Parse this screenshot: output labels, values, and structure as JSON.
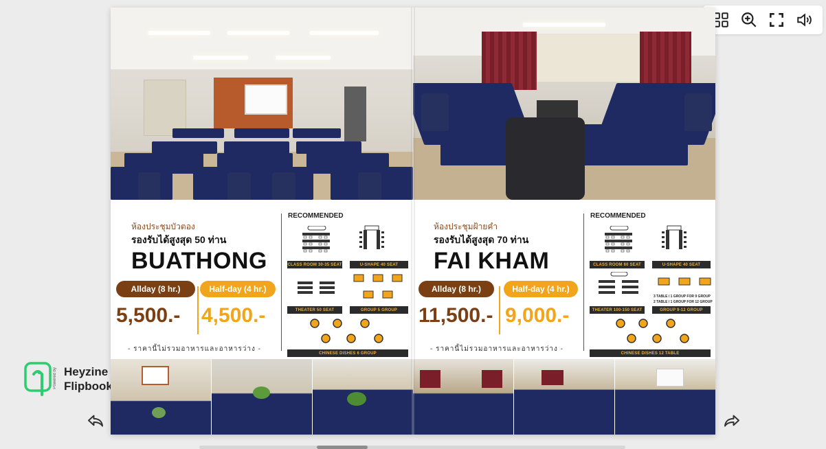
{
  "toolbar": {
    "buttons": [
      {
        "name": "thumbnails",
        "icon": "grid-icon"
      },
      {
        "name": "zoom",
        "icon": "zoom-in-icon"
      },
      {
        "name": "fullscreen",
        "icon": "fullscreen-icon"
      },
      {
        "name": "sound",
        "icon": "speaker-icon"
      }
    ]
  },
  "branding": {
    "powered_by": "Powered by",
    "line1": "Heyzine",
    "line2": "Flipbooks",
    "logo_color": "#2ecc71"
  },
  "navigation": {
    "prev_icon": "arrow-left-icon",
    "next_icon": "arrow-right-icon"
  },
  "pages": {
    "left": {
      "thai_name": "ห้องประชุมบัวตอง",
      "capacity": "รองรับได้สูงสุด 50 ท่าน",
      "room_name": "BUATHONG",
      "allday_label": "Allday (8 hr.)",
      "halfday_label": "Half-day (4 hr.)",
      "allday_price": "5,500.-",
      "halfday_price": "4,500.-",
      "note": "- ราคานี้ไม่รวมอาหารและอาหารว่าง -",
      "recommended": "RECOMMENDED",
      "layouts": {
        "classroom": "CLASS ROOM 30-35 SEAT",
        "ushape": "U-SHAPE 40 SEAT",
        "theater": "THEATER 50 SEAT",
        "group": "GROUP 5 GROUP",
        "chinese": "CHINESE DISHES 6 GROUP"
      }
    },
    "right": {
      "thai_name": "ห้องประชุมฝ้ายคำ",
      "capacity": "รองรับได้สูงสุด 70 ท่าน",
      "room_name": "FAI KHAM",
      "allday_label": "Allday (8 hr.)",
      "halfday_label": "Half-day (4 hr.)",
      "allday_price": "11,500.-",
      "halfday_price": "9,000.-",
      "note": "- ราคานี้ไม่รวมอาหารและอาหารว่าง -",
      "recommended": "RECOMMENDED",
      "layouts": {
        "classroom": "CLASS ROOM 60 SEAT",
        "ushape": "U-SHAPE 40 SEAT",
        "theater": "THEATER 100-150 SEAT",
        "group": "GROUP 9-12 GROUP",
        "group_note1": "3 TABLE / 1 GROUP FOR 9 GROUP",
        "group_note2": "2 TABLE / 1 GROUP FOR 12 GROUP",
        "chinese": "CHINESE DISHES 12 TABLE"
      }
    }
  },
  "colors": {
    "brown": "#7a3f12",
    "orange": "#f0a51c",
    "table_blue": "#1f2a63"
  }
}
